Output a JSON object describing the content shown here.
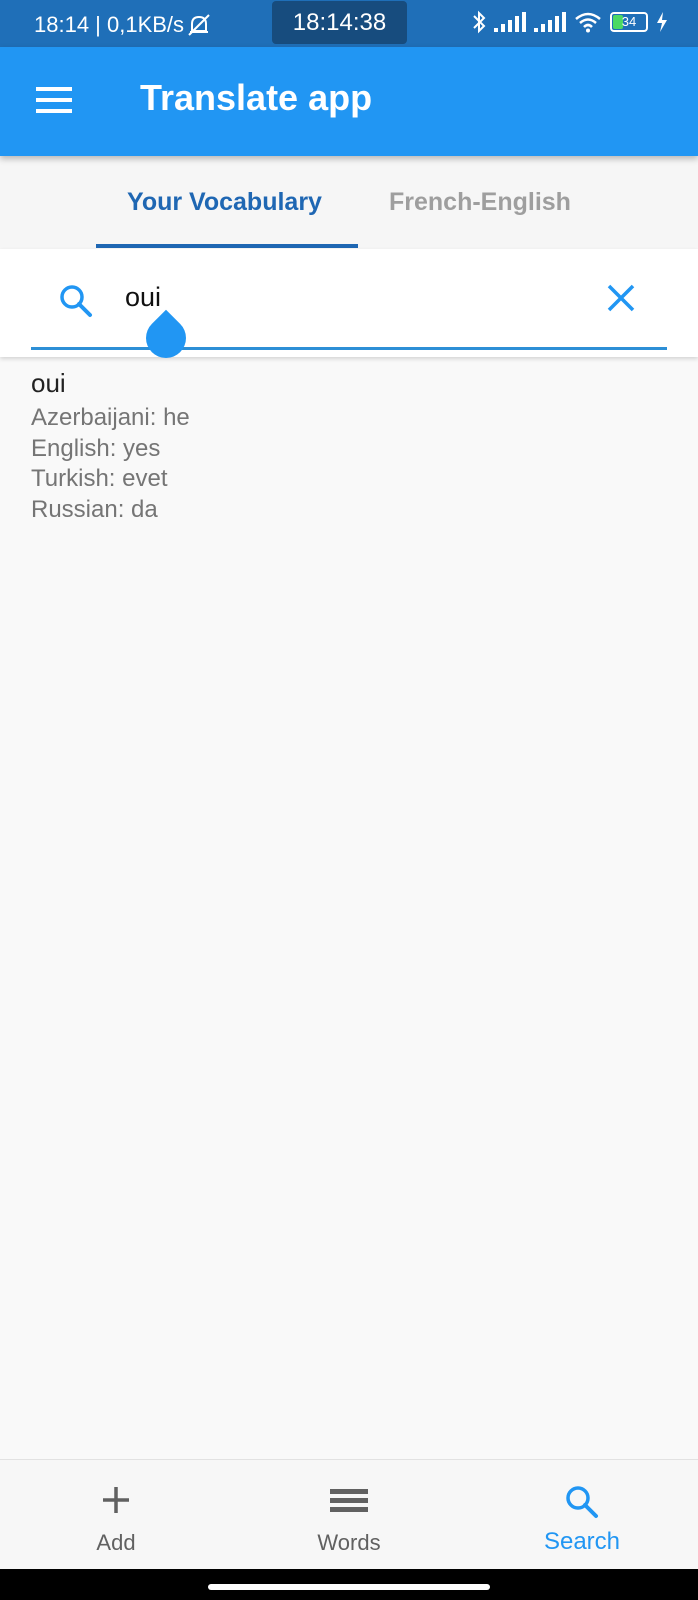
{
  "status_bar": {
    "left_text": "18:14 | 0,1KB/s",
    "clock": "18:14:38",
    "battery": "34",
    "icons": [
      "mute-bell-icon",
      "bluetooth-icon",
      "signal-icon",
      "signal-icon",
      "wifi-icon",
      "battery-icon",
      "charging-icon"
    ]
  },
  "app_bar": {
    "title": "Translate app",
    "menu_icon": "menu-icon"
  },
  "tabs": [
    {
      "label": "Your Vocabulary",
      "active": true
    },
    {
      "label": "French-English",
      "active": false
    }
  ],
  "search": {
    "value": "oui",
    "placeholder": "",
    "search_icon": "search-icon",
    "clear_icon": "close-icon"
  },
  "result": {
    "word": "oui",
    "translations": [
      "Azerbaijani: he",
      "English: yes",
      "Turkish: evet",
      "Russian: da"
    ]
  },
  "bottom_nav": [
    {
      "label": "Add",
      "icon": "plus-icon",
      "active": false
    },
    {
      "label": "Words",
      "icon": "list-icon",
      "active": false
    },
    {
      "label": "Search",
      "icon": "search-icon",
      "active": true
    }
  ],
  "colors": {
    "primary": "#2196f3",
    "status_bar": "#1f6fb8",
    "tab_active": "#1f67b3",
    "tab_inactive": "#9e9e9e",
    "text_secondary": "#757575"
  }
}
